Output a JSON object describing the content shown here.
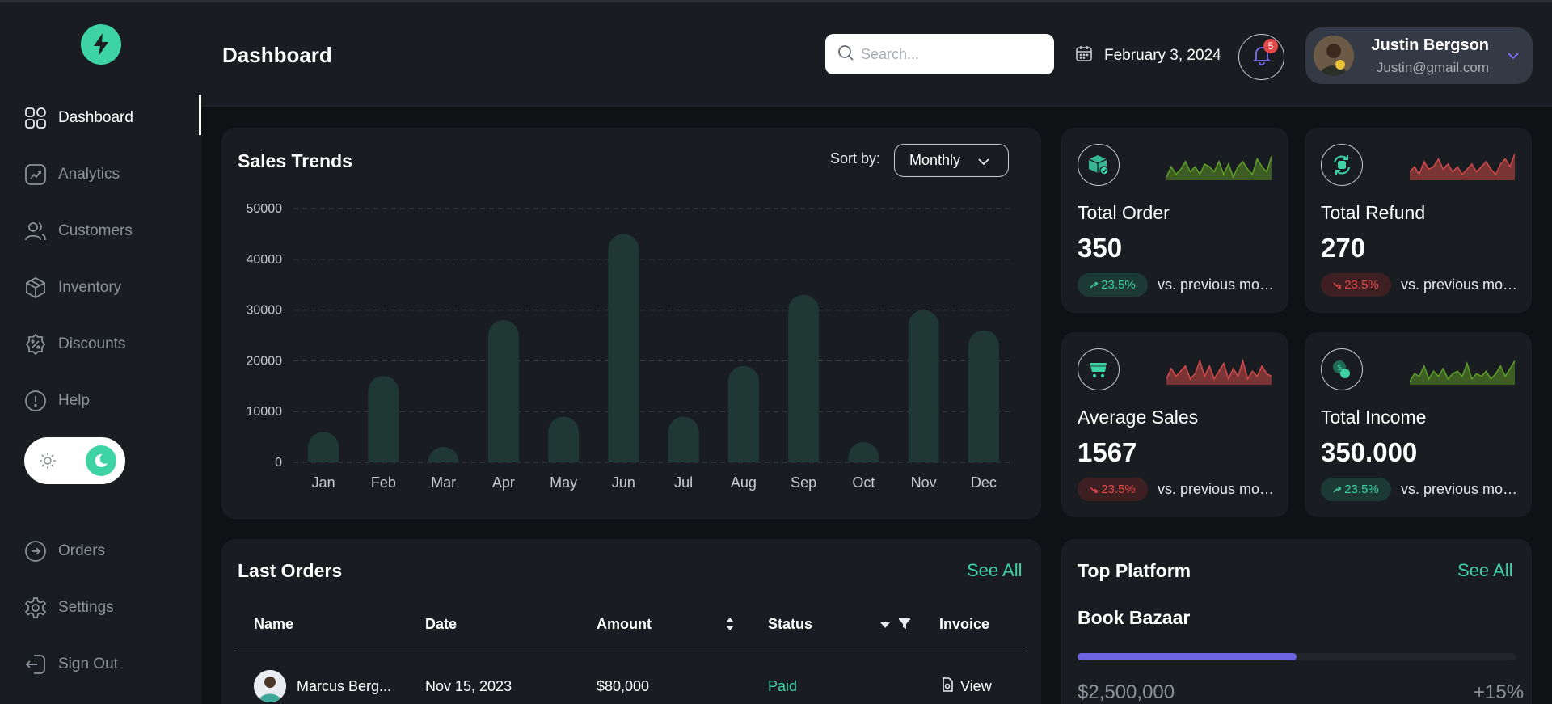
{
  "sidebar": {
    "logo": "lightning-bolt-logo",
    "nav_items": [
      {
        "label": "Dashboard",
        "icon": "dashboard-grid-icon",
        "active": true
      },
      {
        "label": "Analytics",
        "icon": "analytics-chart-icon"
      },
      {
        "label": "Customers",
        "icon": "customers-users-icon"
      },
      {
        "label": "Inventory",
        "icon": "inventory-box-icon"
      },
      {
        "label": "Discounts",
        "icon": "discount-badge-icon"
      },
      {
        "label": "Help",
        "icon": "help-info-icon"
      }
    ],
    "bottom_items": [
      {
        "label": "Orders",
        "icon": "orders-arrow-icon"
      },
      {
        "label": "Settings",
        "icon": "settings-gear-icon"
      },
      {
        "label": "Sign Out",
        "icon": "sign-out-icon"
      }
    ],
    "theme": {
      "mode": "dark"
    }
  },
  "header": {
    "title": "Dashboard",
    "search_placeholder": "Search...",
    "date": "February 3, 2024",
    "notification_count": "5",
    "user": {
      "name": "Justin Bergson",
      "email": "Justin@gmail.com"
    }
  },
  "sales_trends": {
    "title": "Sales Trends",
    "sort_label": "Sort by:",
    "sort_value": "Monthly"
  },
  "chart_data": {
    "type": "bar",
    "title": "Sales Trends",
    "categories": [
      "Jan",
      "Feb",
      "Mar",
      "Apr",
      "May",
      "Jun",
      "Jul",
      "Aug",
      "Sep",
      "Oct",
      "Nov",
      "Dec"
    ],
    "values": [
      6000,
      17000,
      3000,
      28000,
      9000,
      45000,
      9000,
      19000,
      33000,
      4000,
      30000,
      26000
    ],
    "yticks": [
      "50000",
      "40000",
      "30000",
      "20000",
      "10000",
      "0"
    ],
    "ylim": [
      0,
      50000
    ],
    "grid": true,
    "bar_color": "#1f3833"
  },
  "stats": [
    {
      "title": "Total Order",
      "value": "350",
      "change": "23.5%",
      "trend": "up",
      "compare": "vs. previous month",
      "icon": "order-box-icon",
      "spark_color": "#5fa12a",
      "spark_fill": "#3d5d22"
    },
    {
      "title": "Total Refund",
      "value": "270",
      "change": "23.5%",
      "trend": "down",
      "compare": "vs. previous month",
      "icon": "refund-cycle-icon",
      "spark_color": "#d44b4b",
      "spark_fill": "#7a3434"
    },
    {
      "title": "Average Sales",
      "value": "1567",
      "change": "23.5%",
      "trend": "down",
      "compare": "vs. previous month",
      "icon": "cart-icon",
      "spark_color": "#d44b4b",
      "spark_fill": "#7a3434"
    },
    {
      "title": "Total Income",
      "value": "350.000",
      "change": "23.5%",
      "trend": "up",
      "compare": "vs. previous month",
      "icon": "income-coins-icon",
      "spark_color": "#5fa12a",
      "spark_fill": "#3d5d22"
    }
  ],
  "last_orders": {
    "title": "Last Orders",
    "see_all": "See All",
    "columns": [
      "Name",
      "Date",
      "Amount",
      "Status",
      "Invoice"
    ],
    "rows": [
      {
        "name": "Marcus Berg...",
        "date": "Nov 15, 2023",
        "amount": "$80,000",
        "status": "Paid",
        "invoice": "View"
      }
    ]
  },
  "top_platform": {
    "title": "Top Platform",
    "see_all": "See All",
    "items": [
      {
        "name": "Book Bazaar",
        "amount": "$2,500,000",
        "change": "+15%",
        "progress": 0.5
      }
    ]
  },
  "colors": {
    "accent": "#3ed3a3",
    "negative": "#e54848",
    "progress": "#6c63e0"
  }
}
